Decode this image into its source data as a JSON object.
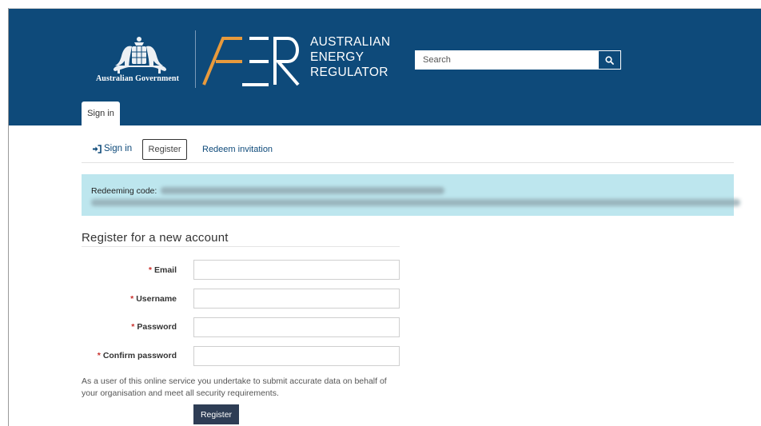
{
  "header": {
    "government_label": "Australian Government",
    "brand_lines": [
      "AUSTRALIAN",
      "ENERGY",
      "REGULATOR"
    ],
    "brand_color": "#0e4a7a",
    "accent_color": "#e89a3c",
    "search": {
      "placeholder": "Search",
      "value": "",
      "icon": "search-icon"
    },
    "tabs": [
      {
        "label": "Sign in",
        "active": true
      }
    ]
  },
  "nav": {
    "items": [
      {
        "label": "Sign in",
        "icon": "sign-in-icon",
        "active": false
      },
      {
        "label": "Register",
        "active": true
      },
      {
        "label": "Redeem invitation",
        "active": false
      }
    ]
  },
  "alert": {
    "label": "Redeeming code:",
    "alert_color": "#bde6ee"
  },
  "form": {
    "title": "Register for a new account",
    "required_marker": "*",
    "fields": [
      {
        "label": "Email",
        "value": ""
      },
      {
        "label": "Username",
        "value": ""
      },
      {
        "label": "Password",
        "value": ""
      },
      {
        "label": "Confirm password",
        "value": ""
      }
    ],
    "notice": "As a user of this online service you undertake to submit accurate data on behalf of your organisation and meet all security requirements.",
    "submit_label": "Register",
    "required_color": "#c9302c"
  }
}
